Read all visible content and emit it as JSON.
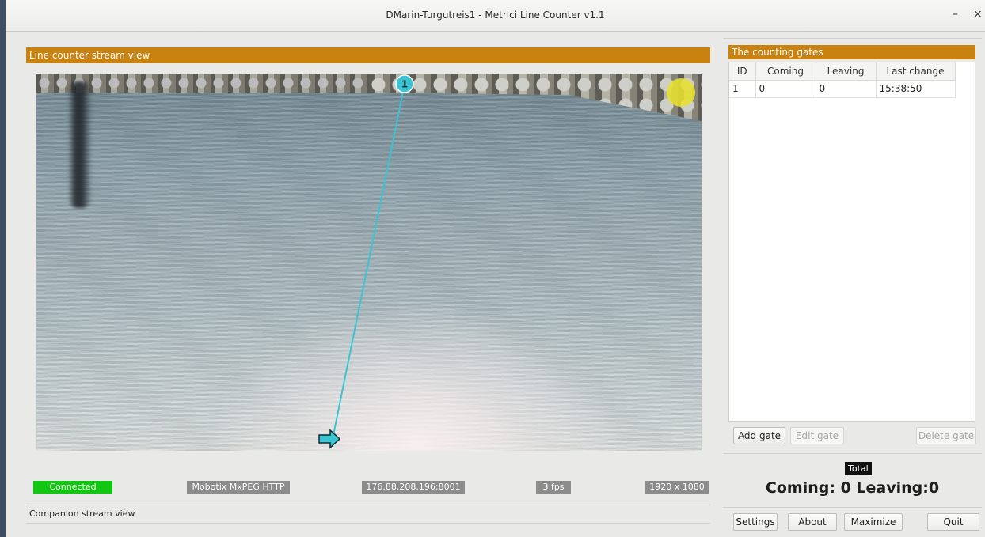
{
  "window": {
    "title": "DMarin-Turgutreis1 - Metrici Line Counter v1.1",
    "minimize_symbol": "–",
    "close_symbol": "×"
  },
  "stream": {
    "header": "Line counter stream view",
    "gate_marker_label": "1",
    "line_color": "#39c4d4",
    "arrow_icon": "arrow-right-icon"
  },
  "status": {
    "connection": "Connected",
    "codec": "Mobotix MxPEG HTTP",
    "address": "176.88.208.196:8001",
    "fps": "3 fps",
    "resolution": "1920 x 1080"
  },
  "companion": {
    "label": "Companion stream view"
  },
  "gates": {
    "header": "The counting gates",
    "columns": [
      "ID",
      "Coming",
      "Leaving",
      "Last change"
    ],
    "rows": [
      {
        "id": "1",
        "coming": "0",
        "leaving": "0",
        "last_change": "15:38:50"
      }
    ],
    "add_label": "Add gate",
    "edit_label": "Edit gate",
    "delete_label": "Delete gate"
  },
  "total": {
    "badge": "Total",
    "summary": "Coming: 0  Leaving:0"
  },
  "buttons": {
    "settings": "Settings",
    "about": "About",
    "maximize": "Maximize",
    "quit": "Quit"
  },
  "colors": {
    "header_orange": "#c9810f",
    "connected_green": "#13c613",
    "status_gray": "#8c8c8c"
  }
}
